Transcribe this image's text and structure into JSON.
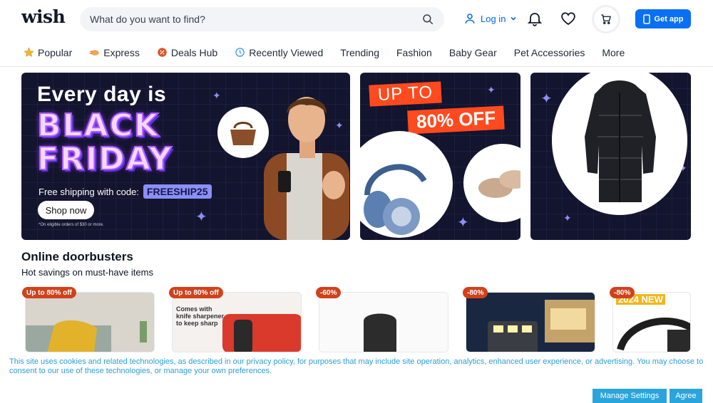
{
  "header": {
    "logo": "wish",
    "search_placeholder": "What do you want to find?",
    "login_label": "Log in",
    "get_app_label": "Get app"
  },
  "nav": {
    "items": [
      {
        "label": "Popular",
        "icon": "star-icon"
      },
      {
        "label": "Express",
        "icon": "express-icon"
      },
      {
        "label": "Deals Hub",
        "icon": "deals-icon"
      },
      {
        "label": "Recently Viewed",
        "icon": "clock-icon"
      },
      {
        "label": "Trending"
      },
      {
        "label": "Fashion"
      },
      {
        "label": "Baby Gear"
      },
      {
        "label": "Pet Accessories"
      },
      {
        "label": "More"
      }
    ]
  },
  "banners": {
    "main": {
      "line1": "Every day is",
      "line2": "BLACK",
      "line3": "FRIDAY",
      "shipping_text": "Free shipping with code:",
      "code": "FREESHIP25",
      "cta": "Shop now",
      "fine_print": "*On eligible orders of $30 or more."
    },
    "sale": {
      "up_to": "UP TO",
      "discount": "80% OFF"
    }
  },
  "section": {
    "title": "Online doorbusters",
    "subtitle": "Hot savings on must-have items"
  },
  "products": [
    {
      "badge": "Up to 80% off"
    },
    {
      "badge": "Up to 80% off",
      "image_text_1": "Comes with",
      "image_text_2": "knife sharpener",
      "image_text_3": "to keep sharp"
    },
    {
      "badge": "-60%"
    },
    {
      "badge": "-80%"
    },
    {
      "badge": "-80%",
      "image_text_1": "2024 NEW"
    }
  ],
  "cookie": {
    "text": "This site uses cookies and related technologies, as described in our privacy policy, for purposes that may include site operation, analytics, enhanced user experience, or advertising. You may choose to consent to our use of these technologies, or manage your own preferences.",
    "manage_label": "Manage Settings",
    "agree_label": "Agree"
  },
  "colors": {
    "brand_blue": "#0a6ff3",
    "badge_red": "#d0421b",
    "banner_bg": "#13142e",
    "cookie_blue": "#29a5dc"
  }
}
